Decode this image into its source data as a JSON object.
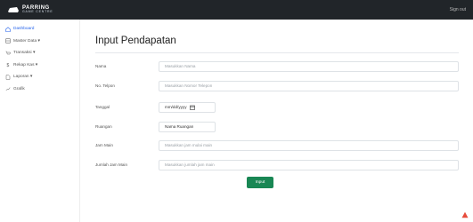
{
  "header": {
    "logo_line1": "PARRING",
    "logo_line2": "GAME CENTRE",
    "signout": "Sign out"
  },
  "sidebar": {
    "items": [
      {
        "label": "Dashboard",
        "icon": "home-icon"
      },
      {
        "label": "Master Data ▾",
        "icon": "database-icon"
      },
      {
        "label": "Transaksi ▾",
        "icon": "cart-icon"
      },
      {
        "label": "Rekap Kas ▾",
        "icon": "dollar-icon"
      },
      {
        "label": "Laporan ▾",
        "icon": "file-icon"
      },
      {
        "label": "Grafik",
        "icon": "chart-icon"
      }
    ]
  },
  "page": {
    "title": "Input Pendapatan"
  },
  "form": {
    "nama": {
      "label": "Nama",
      "placeholder": "Masukkan Nama"
    },
    "telpon": {
      "label": "No. Telpon",
      "placeholder": "Masukkan Nomor Telepon"
    },
    "tanggal": {
      "label": "Tanggal",
      "value": "mm/dd/yyyy"
    },
    "ruangan": {
      "label": "Ruangan",
      "value": "Nama Ruangan"
    },
    "jam_main": {
      "label": "Jam Main",
      "placeholder": "Masukkan jam mulai main"
    },
    "jumlah_jam": {
      "label": "Jumlah Jam Main",
      "placeholder": "Masukkan jumlah jam main"
    },
    "submit": "Input"
  },
  "colors": {
    "topbar": "#212529",
    "accent": "#2563eb",
    "button": "#198754"
  }
}
